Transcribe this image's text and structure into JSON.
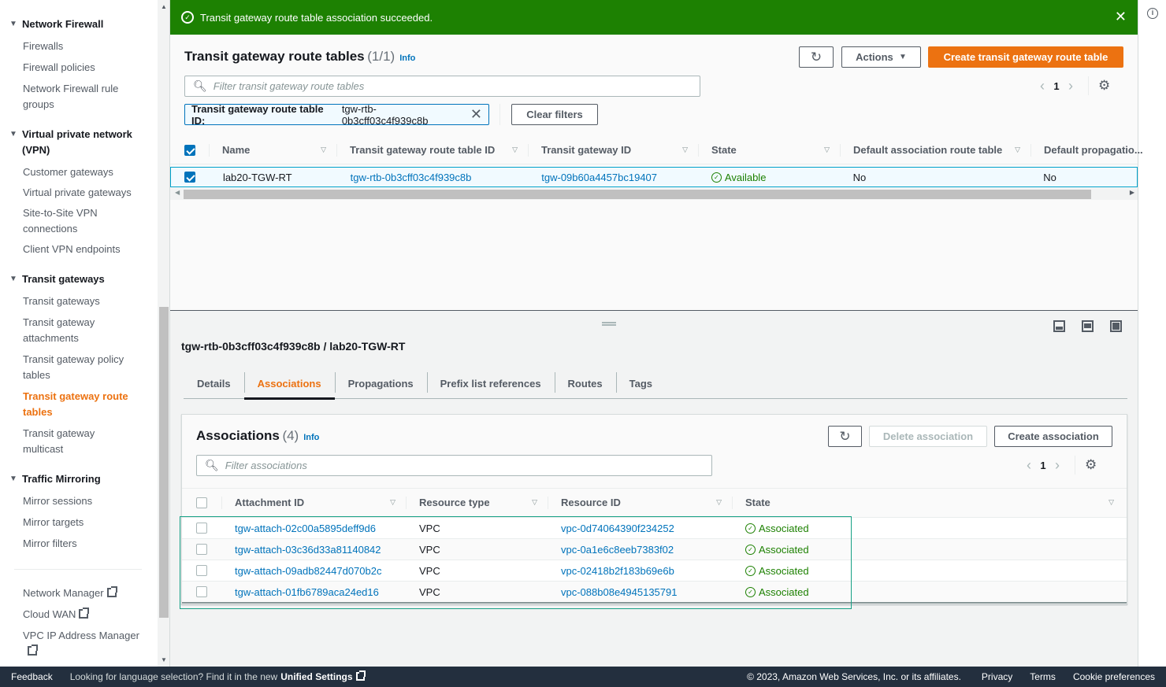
{
  "sidebar": {
    "sections": [
      {
        "title": "Network Firewall",
        "items": [
          "Firewalls",
          "Firewall policies",
          "Network Firewall rule groups"
        ]
      },
      {
        "title": "Virtual private network (VPN)",
        "items": [
          "Customer gateways",
          "Virtual private gateways",
          "Site-to-Site VPN connections",
          "Client VPN endpoints"
        ]
      },
      {
        "title": "Transit gateways",
        "items": [
          "Transit gateways",
          "Transit gateway attachments",
          "Transit gateway policy tables",
          "Transit gateway route tables",
          "Transit gateway multicast"
        ],
        "active_item": "Transit gateway route tables"
      },
      {
        "title": "Traffic Mirroring",
        "items": [
          "Mirror sessions",
          "Mirror targets",
          "Mirror filters"
        ]
      }
    ],
    "external_links": [
      "Network Manager",
      "Cloud WAN",
      "VPC IP Address Manager"
    ]
  },
  "flash": {
    "message": "Transit gateway route table association succeeded.",
    "type": "success",
    "color": "#1d8102"
  },
  "route_tables": {
    "title": "Transit gateway route tables",
    "count": "(1/1)",
    "info": "Info",
    "actions_label": "Actions",
    "create_label": "Create transit gateway route table",
    "filter_placeholder": "Filter transit gateway route tables",
    "filter_token": {
      "key": "Transit gateway route table ID:",
      "value": "tgw-rtb-0b3cff03c4f939c8b"
    },
    "clear_filters": "Clear filters",
    "page": "1",
    "columns": [
      "Name",
      "Transit gateway route table ID",
      "Transit gateway ID",
      "State",
      "Default association route table",
      "Default propagatio..."
    ],
    "rows": [
      {
        "selected": true,
        "name": "lab20-TGW-RT",
        "rtb_id": "tgw-rtb-0b3cff03c4f939c8b",
        "tgw_id": "tgw-09b60a4457bc19407",
        "state": "Available",
        "default_assoc": "No",
        "default_prop": "No"
      }
    ]
  },
  "detail": {
    "title": "tgw-rtb-0b3cff03c4f939c8b / lab20-TGW-RT",
    "tabs": [
      "Details",
      "Associations",
      "Propagations",
      "Prefix list references",
      "Routes",
      "Tags"
    ],
    "active_tab": "Associations",
    "associations": {
      "title": "Associations",
      "count": "(4)",
      "info": "Info",
      "delete_label": "Delete association",
      "create_label": "Create association",
      "filter_placeholder": "Filter associations",
      "page": "1",
      "columns": [
        "Attachment ID",
        "Resource type",
        "Resource ID",
        "State"
      ],
      "rows": [
        {
          "attachment_id": "tgw-attach-02c00a5895deff9d6",
          "resource_type": "VPC",
          "resource_id": "vpc-0d74064390f234252",
          "state": "Associated"
        },
        {
          "attachment_id": "tgw-attach-03c36d33a81140842",
          "resource_type": "VPC",
          "resource_id": "vpc-0a1e6c8eeb7383f02",
          "state": "Associated"
        },
        {
          "attachment_id": "tgw-attach-09adb82447d070b2c",
          "resource_type": "VPC",
          "resource_id": "vpc-02418b2f183b69e6b",
          "state": "Associated"
        },
        {
          "attachment_id": "tgw-attach-01fb6789aca24ed16",
          "resource_type": "VPC",
          "resource_id": "vpc-088b08e4945135791",
          "state": "Associated"
        }
      ]
    }
  },
  "footer": {
    "feedback": "Feedback",
    "language_prompt": "Looking for language selection? Find it in the new",
    "unified_settings": "Unified Settings",
    "copyright": "© 2023, Amazon Web Services, Inc. or its affiliates.",
    "privacy": "Privacy",
    "terms": "Terms",
    "cookies": "Cookie preferences"
  },
  "icons": {
    "success": "✓",
    "close": "✕",
    "caret": "▼",
    "refresh": "↻",
    "search": "⚲",
    "sort": "▽",
    "prev": "‹",
    "next": "›",
    "settings": "⚙",
    "info": "i"
  }
}
